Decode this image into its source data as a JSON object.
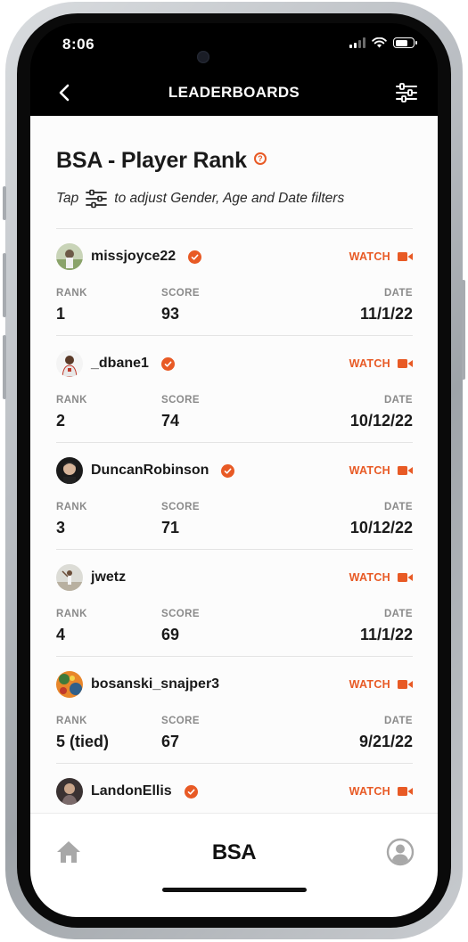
{
  "status_bar": {
    "time": "8:06"
  },
  "header": {
    "title": "LEADERBOARDS"
  },
  "page": {
    "title": "BSA - Player Rank",
    "hint_prefix": "Tap",
    "hint_suffix": "to adjust Gender, Age and Date filters"
  },
  "labels": {
    "rank": "RANK",
    "score": "SCORE",
    "date": "DATE",
    "watch": "WATCH"
  },
  "entries": [
    {
      "username": "missjoyce22",
      "verified": true,
      "rank": "1",
      "score": "93",
      "date": "11/1/22"
    },
    {
      "username": "_dbane1",
      "verified": true,
      "rank": "2",
      "score": "74",
      "date": "10/12/22"
    },
    {
      "username": "DuncanRobinson",
      "verified": true,
      "rank": "3",
      "score": "71",
      "date": "10/12/22"
    },
    {
      "username": "jwetz",
      "verified": false,
      "rank": "4",
      "score": "69",
      "date": "11/1/22"
    },
    {
      "username": "bosanski_snajper3",
      "verified": false,
      "rank": "5 (tied)",
      "score": "67",
      "date": "9/21/22"
    },
    {
      "username": "LandonEllis",
      "verified": true
    }
  ],
  "tabbar": {
    "brand": "BSA",
    "left_icon": "home-icon",
    "right_icon": "profile-icon"
  },
  "colors": {
    "accent": "#e85a25",
    "header_bg": "#000000",
    "content_bg": "#fcfcfc"
  }
}
